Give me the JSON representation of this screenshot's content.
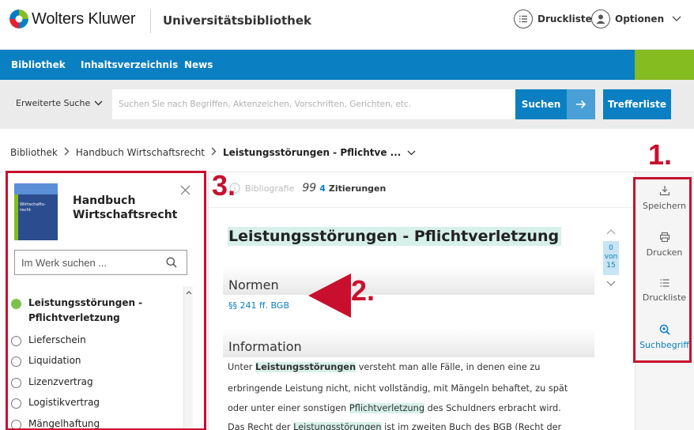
{
  "header": {
    "brand": "Wolters Kluwer",
    "site_title": "Universitätsbibliothek",
    "druckliste_label": "Druckliste",
    "optionen_label": "Optionen"
  },
  "nav": {
    "items": [
      "Bibliothek",
      "Inhaltsverzeichnis",
      "News"
    ]
  },
  "search": {
    "advanced_label": "Erweiterte Suche",
    "placeholder": "Suchen Sie nach Begriffen, Aktenzeichen, Vorschriften, Gerichten, etc.",
    "button_label": "Suchen",
    "results_button_label": "Trefferliste"
  },
  "breadcrumb": {
    "items": [
      "Bibliothek",
      "Handbuch Wirtschaftsrecht"
    ],
    "current": "Leistungsstörungen - Pflichtve ..."
  },
  "sidebar": {
    "cover_text": "Wirtschafts-\nrecht",
    "book_title": "Handbuch Wirtschaftsrecht",
    "search_placeholder": "Im Werk suchen ...",
    "tree": [
      {
        "label": "Leistungsstörungen - Pflichtverletzung",
        "active": true
      },
      {
        "label": "Lieferschein",
        "active": false
      },
      {
        "label": "Liquidation",
        "active": false
      },
      {
        "label": "Lizenzvertrag",
        "active": false
      },
      {
        "label": "Logistikvertrag",
        "active": false
      },
      {
        "label": "Mängelhaftung",
        "active": false
      }
    ]
  },
  "content": {
    "tab_bibliografie": "Bibliografie",
    "tab_zitierungen_count": "4",
    "tab_zitierungen": "Zitierungen",
    "title": "Leistungsstörungen - Pflichtverletzung",
    "normen_heading": "Normen",
    "normen_link": "§§ 241 ff. BGB",
    "info_heading": "Information",
    "paragraph": {
      "l1_a": "Unter ",
      "l1_hl": "Leistungsstörungen",
      "l1_b": " versteht man alle Fälle, in denen eine zu",
      "l2": "erbringende Leistung nicht, nicht vollständig, mit Mängeln behaftet, zu spät",
      "l3_a": "oder unter einer sonstigen ",
      "l3_hl": "Pflichtverletzung",
      "l3_b": " des Schuldners erbracht wird.",
      "l4_a": "Das Recht der ",
      "l4_hl": "Leistungsstörungen",
      "l4_b": " ist im zweiten Buch des BGB (Recht der"
    }
  },
  "pager": {
    "current": "0",
    "sep": "von",
    "total": "15"
  },
  "tools": {
    "save": "Speichern",
    "print": "Drucken",
    "printlist": "Druckliste",
    "searchterm": "Suchbegriff"
  },
  "annotations": {
    "one": "1.",
    "two": "2.",
    "three": "3."
  },
  "colors": {
    "brand_blue": "#0a7fc2",
    "brand_green": "#85bc20",
    "annotation_red": "#c8102e",
    "highlight": "#d7f0ea"
  }
}
